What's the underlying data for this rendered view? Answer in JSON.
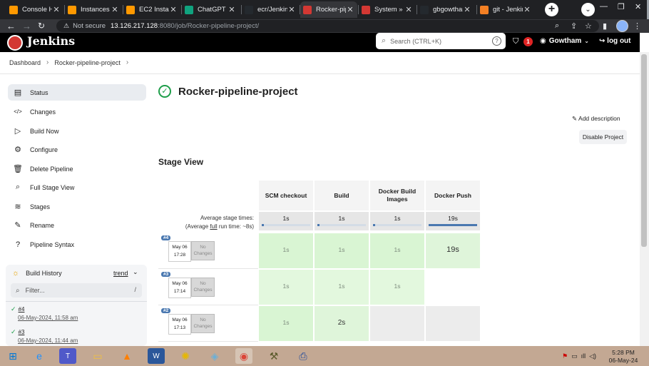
{
  "browser": {
    "tabs": [
      {
        "title": "Console Ho",
        "fav_color": "#f90",
        "active": false
      },
      {
        "title": "Instances |",
        "fav_color": "#f90",
        "active": false
      },
      {
        "title": "EC2 Instanc",
        "fav_color": "#f90",
        "active": false
      },
      {
        "title": "ChatGPT",
        "fav_color": "#10a37f",
        "active": false
      },
      {
        "title": "ecr/Jenkins",
        "fav_color": "#24292e",
        "active": false
      },
      {
        "title": "Rocker-pip",
        "fav_color": "#d33833",
        "active": true
      },
      {
        "title": "System » G",
        "fav_color": "#d33833",
        "active": false
      },
      {
        "title": "gbgowthan",
        "fav_color": "#24292e",
        "active": false
      },
      {
        "title": "git - Jenkin",
        "fav_color": "#f48024",
        "active": false
      }
    ],
    "address": {
      "security": "Not secure",
      "host": "13.126.217.128",
      "path": ":8080/job/Rocker-pipeline-project/"
    }
  },
  "jenkins": {
    "brand": "Jenkins",
    "search_placeholder": "Search (CTRL+K)",
    "notification_count": "1",
    "user": "Gowtham",
    "logout": "log out"
  },
  "breadcrumb": [
    "Dashboard",
    "Rocker-pipeline-project"
  ],
  "sidebar": {
    "items": [
      {
        "label": "Status",
        "icon": "document-icon",
        "glyph": "▤",
        "selected": true
      },
      {
        "label": "Changes",
        "icon": "code-icon",
        "glyph": "</>",
        "selected": false
      },
      {
        "label": "Build Now",
        "icon": "play-icon",
        "glyph": "▷",
        "selected": false
      },
      {
        "label": "Configure",
        "icon": "gear-icon",
        "glyph": "⚙",
        "selected": false
      },
      {
        "label": "Delete Pipeline",
        "icon": "trash-icon",
        "glyph": "🗑",
        "selected": false
      },
      {
        "label": "Full Stage View",
        "icon": "search-icon",
        "glyph": "⌕",
        "selected": false
      },
      {
        "label": "Stages",
        "icon": "layers-icon",
        "glyph": "≋",
        "selected": false
      },
      {
        "label": "Rename",
        "icon": "pencil-icon",
        "glyph": "✎",
        "selected": false
      },
      {
        "label": "Pipeline Syntax",
        "icon": "help-icon",
        "glyph": "?",
        "selected": false
      }
    ]
  },
  "build_history": {
    "title": "Build History",
    "trend": "trend",
    "filter_placeholder": "Filter...",
    "filter_shortcut": "/",
    "builds": [
      {
        "number": "#4",
        "date": "06-May-2024, 11:58 am"
      },
      {
        "number": "#3",
        "date": "06-May-2024, 11:44 am"
      }
    ]
  },
  "project": {
    "title": "Rocker-pipeline-project",
    "add_description": "Add description",
    "disable_project": "Disable Project"
  },
  "stage_view": {
    "title": "Stage View",
    "avg_label_1": "Average stage times:",
    "avg_label_2a": "(Average ",
    "avg_label_2b": "full",
    "avg_label_2c": " run time: ~8s)",
    "stages": [
      {
        "name": "SCM checkout",
        "avg": "1s",
        "avg_fraction": 0.05
      },
      {
        "name": "Build",
        "avg": "1s",
        "avg_fraction": 0.05
      },
      {
        "name": "Docker Build Images",
        "avg": "1s",
        "avg_fraction": 0.05
      },
      {
        "name": "Docker Push",
        "avg": "19s",
        "avg_fraction": 1.0
      }
    ],
    "runs": [
      {
        "badge": "#4",
        "date": "May 06",
        "time": "17:28",
        "changes": "No Changes",
        "cells": [
          "1s",
          "1s",
          "1s",
          "19s"
        ]
      },
      {
        "badge": "#3",
        "date": "May 06",
        "time": "17:14",
        "changes": "No Changes",
        "cells": [
          "1s",
          "1s",
          "1s",
          ""
        ]
      },
      {
        "badge": "#2",
        "date": "May 06",
        "time": "17:13",
        "changes": "No Changes",
        "cells": [
          "1s",
          "2s",
          "",
          ""
        ]
      }
    ]
  },
  "taskbar": {
    "time": "5:28 PM",
    "date": "06-May-24"
  }
}
